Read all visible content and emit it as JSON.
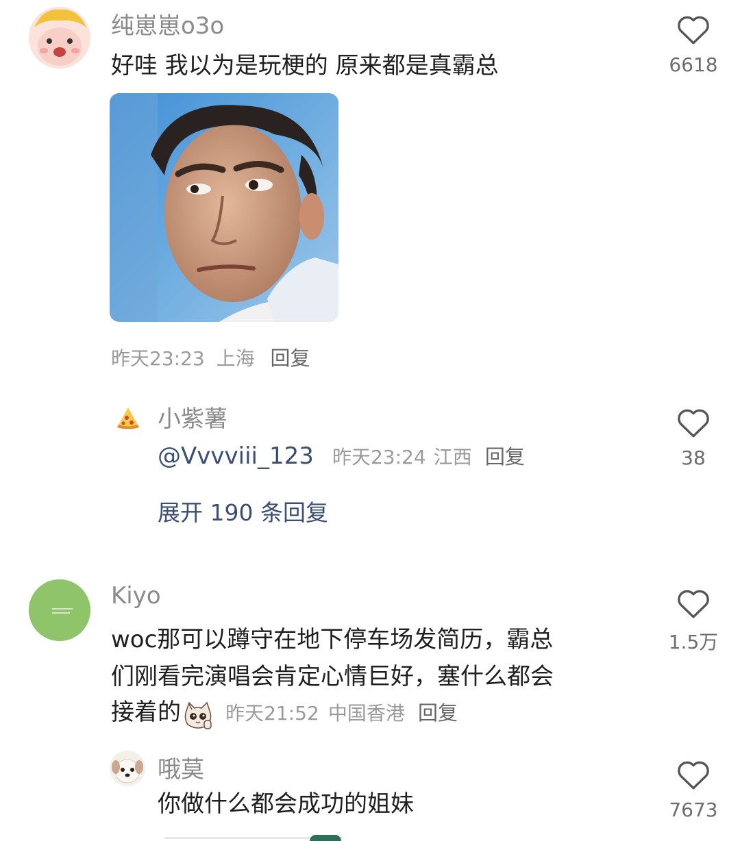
{
  "comments": [
    {
      "username": "纯崽崽o3o",
      "text": "好哇 我以为是玩梗的 原来都是真霸总",
      "time": "昨天23:23",
      "location": "上海",
      "reply_label": "回复",
      "likes": "6618",
      "sub_reply": {
        "username": "小紫薯",
        "mention": "@Vvvviii_123",
        "time": "昨天23:24",
        "location": "江西",
        "reply_label": "回复",
        "likes": "38"
      },
      "expand_label": "展开 190 条回复"
    },
    {
      "username": "Kiyo",
      "text_lines": [
        "woc那可以蹲守在地下停车场发简历，霸总",
        "们刚看完演唱会肯定心情巨好，塞什么都会",
        "接着的"
      ],
      "time": "昨天21:52",
      "location": "中国香港",
      "reply_label": "回复",
      "likes": "1.5万",
      "sub_reply": {
        "username": "哦莫",
        "text": "你做什么都会成功的姐妹",
        "likes": "7673"
      }
    }
  ],
  "icons": {
    "like": "heart-outline-icon",
    "avatar_1": "cartoon-pig-avatar",
    "avatar_2": "pizza-slice-avatar",
    "avatar_3": "green-circle-avatar",
    "avatar_4": "puppy-avatar",
    "emoji": "cat-emoji"
  },
  "colors": {
    "link": "#3a4e74",
    "meta": "#9a9a9a",
    "username": "#8a8a8a",
    "avatar_green": "#8fc46b"
  }
}
